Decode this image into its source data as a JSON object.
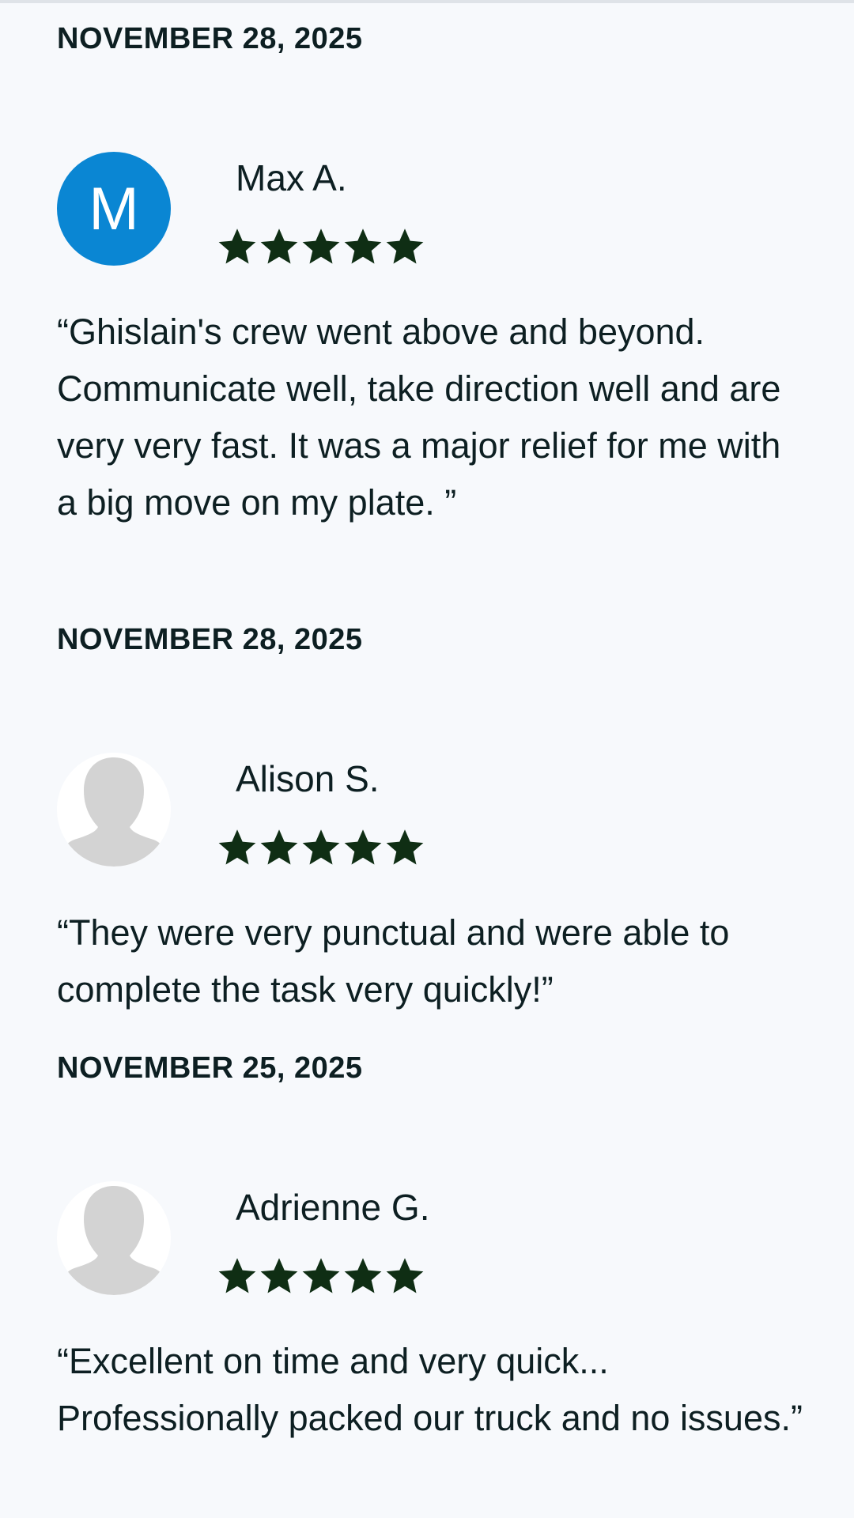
{
  "reviews": [
    {
      "date": "NOVEMBER 28, 2025",
      "avatar_letter": "M",
      "avatar_color": "#0a86d3",
      "name": "Max A.",
      "rating": 5,
      "text": "“Ghislain's crew went above and beyond. Communicate well, take direction well and are very very fast. It was a major relief for me with a big move on my plate. ”"
    },
    {
      "date": "NOVEMBER 28, 2025",
      "avatar_letter": "",
      "name": "Alison S.",
      "rating": 5,
      "text": "“They were very punctual and were able to complete the task very quickly!”"
    },
    {
      "date": "NOVEMBER 25, 2025",
      "avatar_letter": "",
      "name": "Adrienne G.",
      "rating": 5,
      "text": "“Excellent on time and very quick... Professionally packed our truck and no issues.”"
    }
  ],
  "colors": {
    "star": "#0f2e14",
    "background": "#f7f9fc",
    "text": "#0d1f22",
    "placeholder_avatar": "#d3d3d3"
  }
}
